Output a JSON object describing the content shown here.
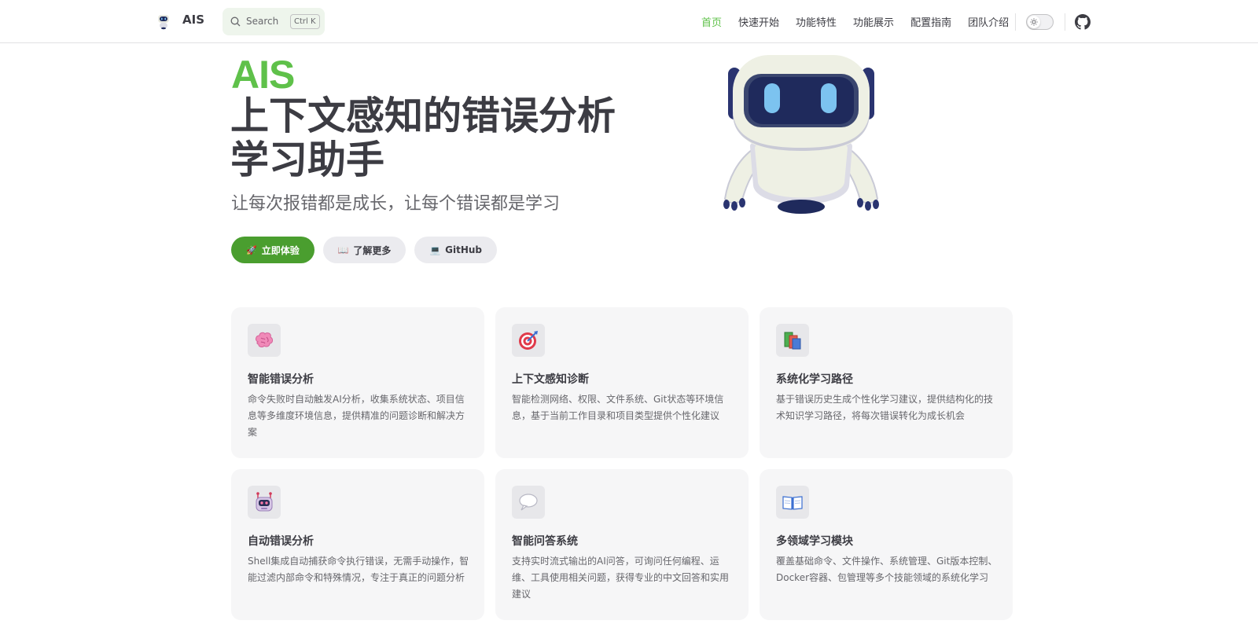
{
  "nav": {
    "brand": "AIS",
    "search_label": "Search",
    "search_shortcut": "Ctrl K",
    "links": [
      "首页",
      "快速开始",
      "功能特性",
      "功能展示",
      "配置指南",
      "团队介绍"
    ],
    "active_link": "首页",
    "icons": [
      "robot-logo-icon",
      "search-icon",
      "sun-icon",
      "github-icon"
    ]
  },
  "hero": {
    "name": "AIS",
    "text": "上下文感知的错误分析学习助手",
    "tagline": "让每次报错都是成长，让每个错误都是学习",
    "actions": [
      {
        "emoji": "🚀",
        "label": "立即体验",
        "theme": "brand"
      },
      {
        "emoji": "📖",
        "label": "了解更多",
        "theme": "alt"
      },
      {
        "emoji": "💻",
        "label": "GitHub",
        "theme": "alt"
      }
    ]
  },
  "features": [
    {
      "icon": "brain-icon",
      "title": "智能错误分析",
      "desc": "命令失败时自动触发AI分析，收集系统状态、项目信息等多维度环境信息，提供精准的问题诊断和解决方案"
    },
    {
      "icon": "target-icon",
      "title": "上下文感知诊断",
      "desc": "智能检测网络、权限、文件系统、Git状态等环境信息，基于当前工作目录和项目类型提供个性化建议"
    },
    {
      "icon": "books-icon",
      "title": "系统化学习路径",
      "desc": "基于错误历史生成个性化学习建议，提供结构化的技术知识学习路径，将每次错误转化为成长机会"
    },
    {
      "icon": "robot-icon",
      "title": "自动错误分析",
      "desc": "Shell集成自动捕获命令执行错误，无需手动操作，智能过滤内部命令和特殊情况，专注于真正的问题分析"
    },
    {
      "icon": "speech-bubble-icon",
      "title": "智能问答系统",
      "desc": "支持实时流式输出的AI问答，可询问任何编程、运维、工具使用相关问题，获得专业的中文回答和实用建议"
    },
    {
      "icon": "open-book-icon",
      "title": "多领域学习模块",
      "desc": "覆盖基础命令、文件操作、系统管理、Git版本控制、Docker容器、包管理等多个技能领域的系统化学习"
    }
  ],
  "colors": {
    "brand": "#5fc14a",
    "button_primary": "#4a9e2f",
    "text": "#3c3c43",
    "text_muted": "#67676c",
    "card_bg": "#f6f6f7"
  }
}
